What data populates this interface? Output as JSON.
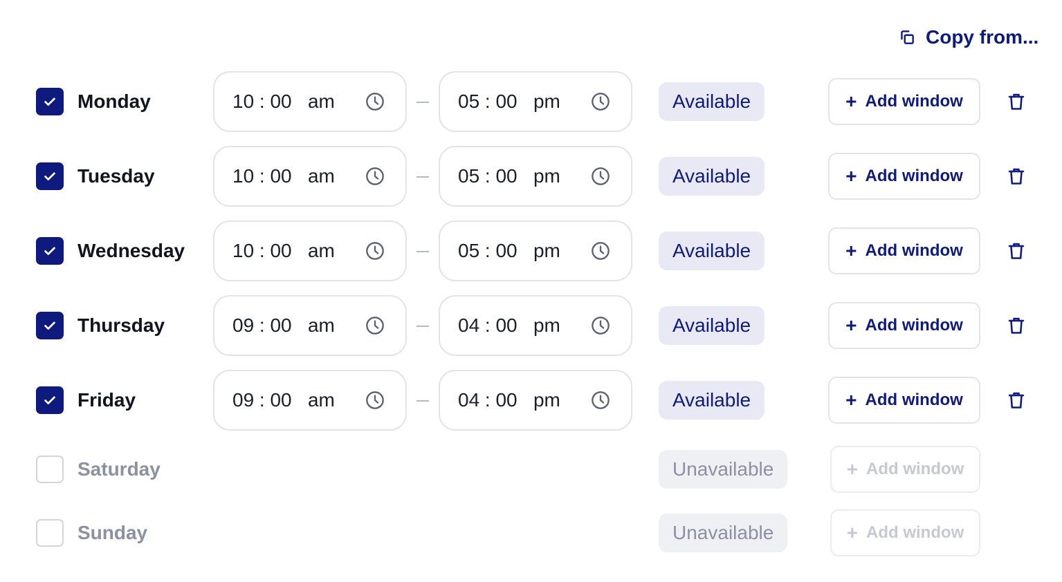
{
  "header": {
    "copy_from_label": "Copy from..."
  },
  "rows": [
    {
      "day": "Monday",
      "checked": true,
      "start": "10 : 00   am",
      "end": "05 : 00   pm",
      "status": "Available",
      "add_label": "Add window"
    },
    {
      "day": "Tuesday",
      "checked": true,
      "start": "10 : 00   am",
      "end": "05 : 00   pm",
      "status": "Available",
      "add_label": "Add window"
    },
    {
      "day": "Wednesday",
      "checked": true,
      "start": "10 : 00   am",
      "end": "05 : 00   pm",
      "status": "Available",
      "add_label": "Add window"
    },
    {
      "day": "Thursday",
      "checked": true,
      "start": "09 : 00   am",
      "end": "04 : 00   pm",
      "status": "Available",
      "add_label": "Add window"
    },
    {
      "day": "Friday",
      "checked": true,
      "start": "09 : 00   am",
      "end": "04 : 00   pm",
      "status": "Available",
      "add_label": "Add window"
    },
    {
      "day": "Saturday",
      "checked": false,
      "status": "Unavailable",
      "add_label": "Add window"
    },
    {
      "day": "Sunday",
      "checked": false,
      "status": "Unavailable",
      "add_label": "Add window"
    }
  ],
  "colors": {
    "accent": "#0e1a7e",
    "available_bg": "#e8e9f5",
    "unavailable_bg": "#eef0f4",
    "muted_text": "#8b90a3",
    "border": "#e3e4ea"
  },
  "icons": {
    "copy": "copy-icon",
    "check": "check-icon",
    "clock": "clock-icon",
    "plus": "plus-icon",
    "trash": "trash-icon"
  }
}
